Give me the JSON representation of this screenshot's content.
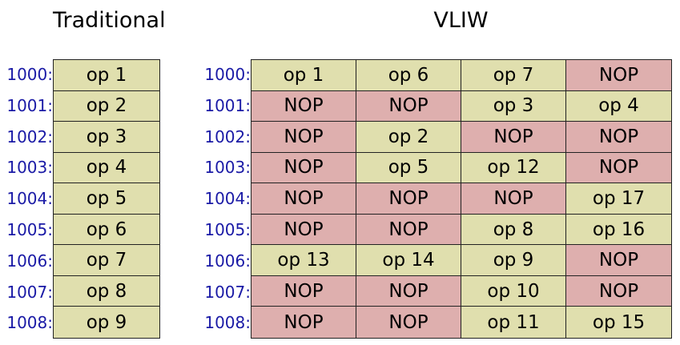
{
  "titles": {
    "traditional": "Traditional",
    "vliw": "VLIW"
  },
  "addresses": [
    "1000:",
    "1001:",
    "1002:",
    "1003:",
    "1004:",
    "1005:",
    "1006:",
    "1007:",
    "1008:"
  ],
  "traditional": [
    "op 1",
    "op 2",
    "op 3",
    "op 4",
    "op 5",
    "op 6",
    "op 7",
    "op 8",
    "op 9"
  ],
  "vliw": [
    [
      "op 1",
      "op 6",
      "op 7",
      "NOP"
    ],
    [
      "NOP",
      "NOP",
      "op 3",
      "op 4"
    ],
    [
      "NOP",
      "op 2",
      "NOP",
      "NOP"
    ],
    [
      "NOP",
      "op 5",
      "op 12",
      "NOP"
    ],
    [
      "NOP",
      "NOP",
      "NOP",
      "op 17"
    ],
    [
      "NOP",
      "NOP",
      "op 8",
      "op 16"
    ],
    [
      "op 13",
      "op 14",
      "op 9",
      "NOP"
    ],
    [
      "NOP",
      "NOP",
      "op 10",
      "NOP"
    ],
    [
      "NOP",
      "NOP",
      "op 11",
      "op 15"
    ]
  ],
  "colors": {
    "op_fill": "#e0dfae",
    "nop_fill": "#deafae",
    "address_text": "#1a1aa6"
  }
}
